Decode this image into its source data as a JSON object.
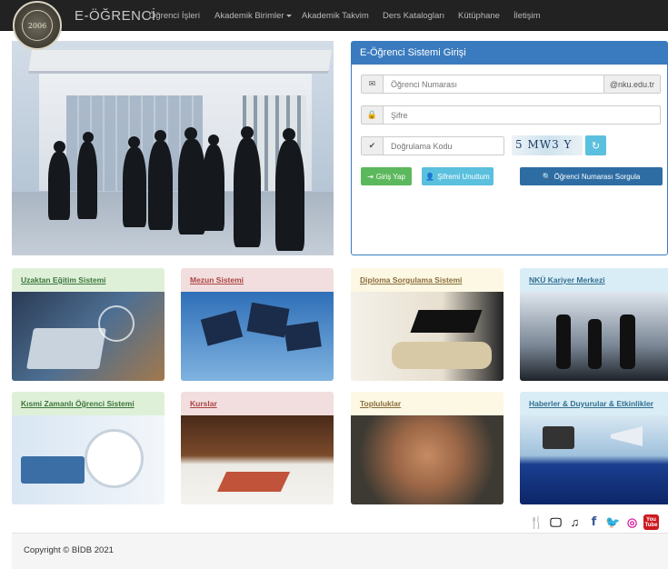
{
  "brand": {
    "title": "E-ÖĞRENCİ",
    "logo_text": "2006"
  },
  "nav": {
    "items": [
      {
        "label": "Öğrenci İşleri"
      },
      {
        "label": "Akademik Birimler"
      },
      {
        "label": "Akademik Takvim"
      },
      {
        "label": "Ders Katalogları"
      },
      {
        "label": "Kütüphane"
      },
      {
        "label": "İletişim"
      }
    ]
  },
  "login": {
    "title": "E-Öğrenci Sistemi Girişi",
    "student_no_placeholder": "Öğrenci Numarası",
    "email_suffix": "@nku.edu.tr",
    "password_placeholder": "Şifre",
    "verify_placeholder": "Doğrulama Kodu",
    "captcha_text": "5 MW3 Y",
    "login_button": "Giriş Yap",
    "forgot_button": "Şifremi Unuttum",
    "query_button": "Öğrenci Numarası Sorgula"
  },
  "cards": [
    {
      "label": "Uzaktan Eğitim Sistemi"
    },
    {
      "label": "Mezun Sistemi"
    },
    {
      "label": "Diploma Sorgulama Sistemi"
    },
    {
      "label": "NKÜ Kariyer Merkezi"
    },
    {
      "label": "Kısmi Zamanlı Öğrenci Sistemi"
    },
    {
      "label": "Kurslar"
    },
    {
      "label": "Topluluklar"
    },
    {
      "label": "Haberler & Duyurular & Etkinlikler"
    }
  ],
  "social": {
    "icons": [
      "food-icon",
      "tv-icon",
      "music-icon",
      "facebook-icon",
      "twitter-icon",
      "instagram-icon",
      "youtube-icon"
    ],
    "youtube_text": "You Tube"
  },
  "footer": {
    "copyright": "Copyright © BİDB 2021"
  },
  "colors": {
    "navbar": "#222222",
    "primary": "#3a7bbf",
    "success": "#5cb85c",
    "info": "#5bc0de",
    "query": "#2e6da4"
  }
}
